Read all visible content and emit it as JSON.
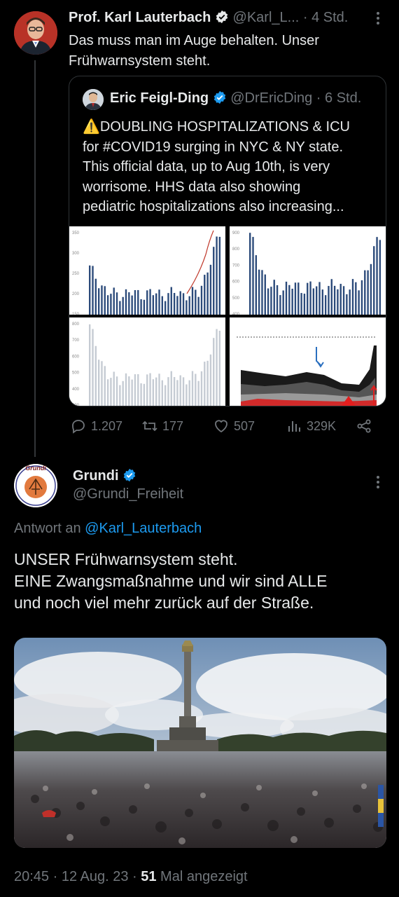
{
  "tweet1": {
    "name": "Prof. Karl Lauterbach",
    "handle": "@Karl_L...",
    "time": "· 4 Std.",
    "text_line1": "Das muss man im Auge behalten. Unser",
    "text_line2": "Frühwarnsystem steht."
  },
  "quote": {
    "name": "Eric Feigl-Ding",
    "handle": "@DrEricDing",
    "time": "· 6 Std.",
    "lines": [
      "⚠️DOUBLING HOSPITALIZATIONS & ICU",
      "for #COVID19 surging in NYC & NY state.",
      "This official data, up to Aug 10th, is very",
      "worrisome. HHS data also showing",
      "pediatric hospitalizations also increasing..."
    ],
    "chart1_ticks": [
      "350",
      "300",
      "250",
      "200",
      "150"
    ],
    "chart2_ticks": [
      "900",
      "800",
      "700",
      "600",
      "500",
      "400"
    ],
    "chart3_ticks": [
      "800",
      "700",
      "600",
      "500",
      "400",
      "300"
    ]
  },
  "actions": {
    "replies": "1.207",
    "retweets": "177",
    "likes": "507",
    "views": "329K"
  },
  "reply": {
    "name": "Grundi",
    "handle": "@Grundi_Freiheit",
    "avatar_label": "Grundi",
    "reply_prefix": "Antwort an",
    "reply_to": "@Karl_Lauterbach",
    "line1": "UNSER Frühwarnsystem steht.",
    "line2": "EINE Zwangsmaßnahme und wir sind ALLE",
    "line3": "und noch viel mehr zurück auf der Straße."
  },
  "footer": {
    "time": "20:45 · 12 Aug. 23 · ",
    "views": "51",
    "views_label": " Mal angezeigt"
  },
  "colors": {
    "accent": "#1d9bf0",
    "muted": "#71767b",
    "bar": "#2b4a7a"
  }
}
